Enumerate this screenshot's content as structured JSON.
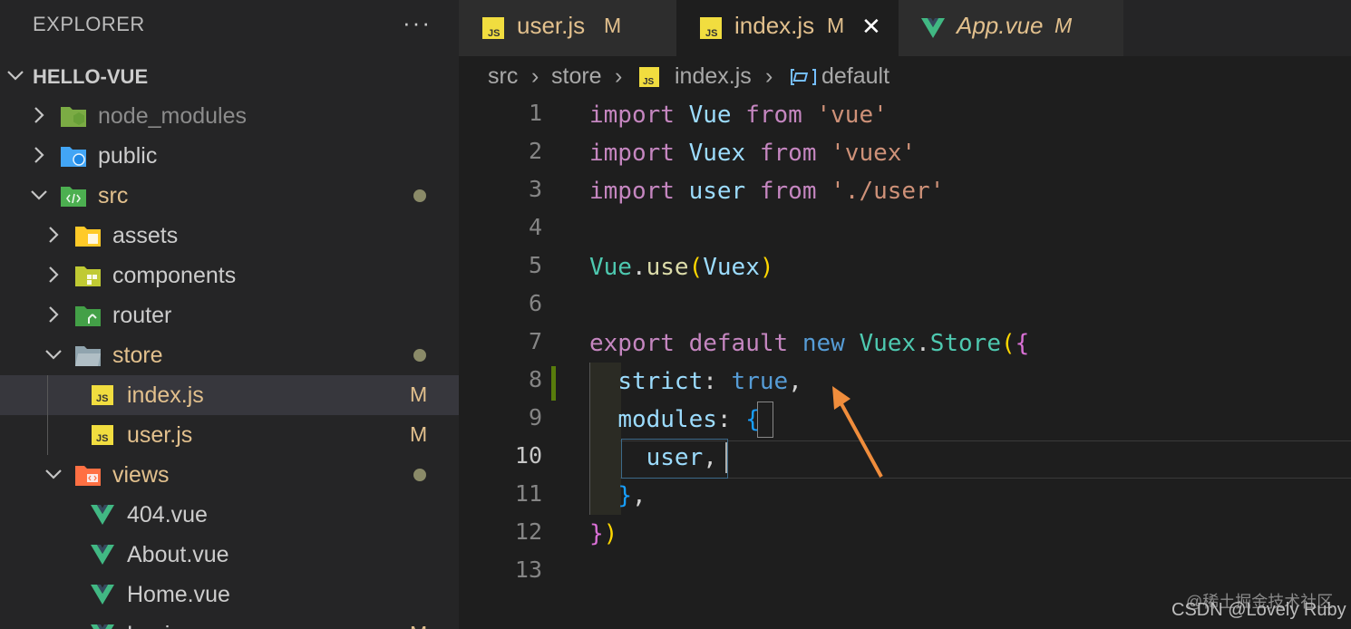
{
  "sidebar": {
    "title": "EXPLORER",
    "more": "···",
    "project": "HELLO-VUE",
    "items": [
      {
        "label": "node_modules"
      },
      {
        "label": "public"
      },
      {
        "label": "src"
      },
      {
        "label": "assets"
      },
      {
        "label": "components"
      },
      {
        "label": "router"
      },
      {
        "label": "store"
      },
      {
        "label": "index.js",
        "badge": "M"
      },
      {
        "label": "user.js",
        "badge": "M"
      },
      {
        "label": "views"
      },
      {
        "label": "404.vue"
      },
      {
        "label": "About.vue"
      },
      {
        "label": "Home.vue"
      },
      {
        "label": "Login.vue",
        "badge": "M"
      }
    ]
  },
  "tabs": [
    {
      "label": "user.js",
      "badge": "M"
    },
    {
      "label": "index.js",
      "badge": "M",
      "close": "✕"
    },
    {
      "label": "App.vue",
      "badge": "M"
    }
  ],
  "breadcrumb": {
    "p1": "src",
    "p2": "store",
    "p3": "index.js",
    "p4": "default",
    "sep": "›"
  },
  "editor": {
    "line_numbers": [
      "1",
      "2",
      "3",
      "4",
      "5",
      "6",
      "7",
      "8",
      "9",
      "10",
      "11",
      "12",
      "13"
    ],
    "current_line": 10,
    "tokens": {
      "import": "import",
      "from": "from",
      "Vue": "Vue",
      "vue_str": "'vue'",
      "Vuex": "Vuex",
      "vuex_str": "'vuex'",
      "user": "user",
      "user_str": "'./user'",
      "dot": ".",
      "use": "use",
      "lp": "(",
      "rp": ")",
      "export": "export",
      "default": "default",
      "new": "new",
      "Store": "Store",
      "lb": "{",
      "rb": "}",
      "strict": "strict",
      "colon": ": ",
      "true": "true",
      "comma": ",",
      "modules": "modules"
    }
  },
  "colors": {
    "accent_modified": "#e2c08d",
    "vue_green": "#41b883",
    "js_yellow": "#f1dd3f",
    "arrow": "#f08d3c"
  },
  "watermark": {
    "line1": "@稀土掘金技术社区",
    "line2": "CSDN @Lovely Ruby"
  }
}
